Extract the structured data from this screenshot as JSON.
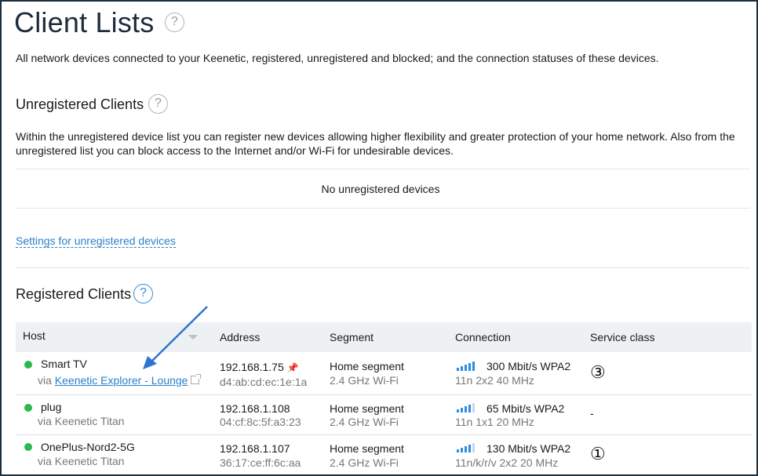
{
  "page": {
    "title": "Client Lists",
    "help": "?",
    "description": "All network devices connected to your Keenetic, registered, unregistered and blocked; and the connection statuses of these devices."
  },
  "unregistered": {
    "title": "Unregistered Clients",
    "description": "Within the unregistered device list you can register new devices allowing higher flexibility and greater protection of your home network. Also from the unregistered list you can block access to the Internet and/or Wi-Fi for undesirable devices.",
    "empty_text": "No unregistered devices",
    "settings_link": "Settings for unregistered devices"
  },
  "registered": {
    "title": "Registered Clients",
    "columns": [
      "Host",
      "Address",
      "Segment",
      "Connection",
      "Service class"
    ],
    "rows": [
      {
        "name": "Smart TV",
        "via_prefix": "via ",
        "via_link": "Keenetic Explorer - Lounge",
        "ip": "192.168.1.75",
        "mac": "d4:ab:cd:ec:1e:1a",
        "segment": "Home segment",
        "band": "2.4 GHz Wi-Fi",
        "rate": "300 Mbit/s WPA2",
        "mode": "11n 2x2 40 MHz",
        "signal_bars": 5,
        "service_class": "③",
        "status_color": "#2db84d"
      },
      {
        "name": "plug",
        "via": "via Keenetic Titan",
        "ip": "192.168.1.108",
        "mac": "04:cf:8c:5f:a3:23",
        "segment": "Home segment",
        "band": "2.4 GHz Wi-Fi",
        "rate": "65 Mbit/s WPA2",
        "mode": "11n 1x1 20 MHz",
        "signal_bars": 4,
        "service_class": "-",
        "status_color": "#2db84d"
      },
      {
        "name": "OnePlus-Nord2-5G",
        "via": "via Keenetic Titan",
        "ip": "192.168.1.107",
        "mac": "36:17:ce:ff:6c:aa",
        "segment": "Home segment",
        "band": "2.4 GHz Wi-Fi",
        "rate": "130 Mbit/s WPA2",
        "mode": "11n/k/r/v 2x2 20 MHz",
        "signal_bars": 4,
        "service_class": "①",
        "status_color": "#2db84d"
      }
    ]
  },
  "colors": {
    "accent": "#2a7fc9",
    "status_online": "#2db84d",
    "annotation_arrow": "#2f74d0"
  },
  "icons": {
    "help": "help-circle-icon",
    "sort": "sort-caret-icon",
    "pin": "pin-icon",
    "external": "external-link-icon",
    "signal": "signal-bars-icon"
  }
}
